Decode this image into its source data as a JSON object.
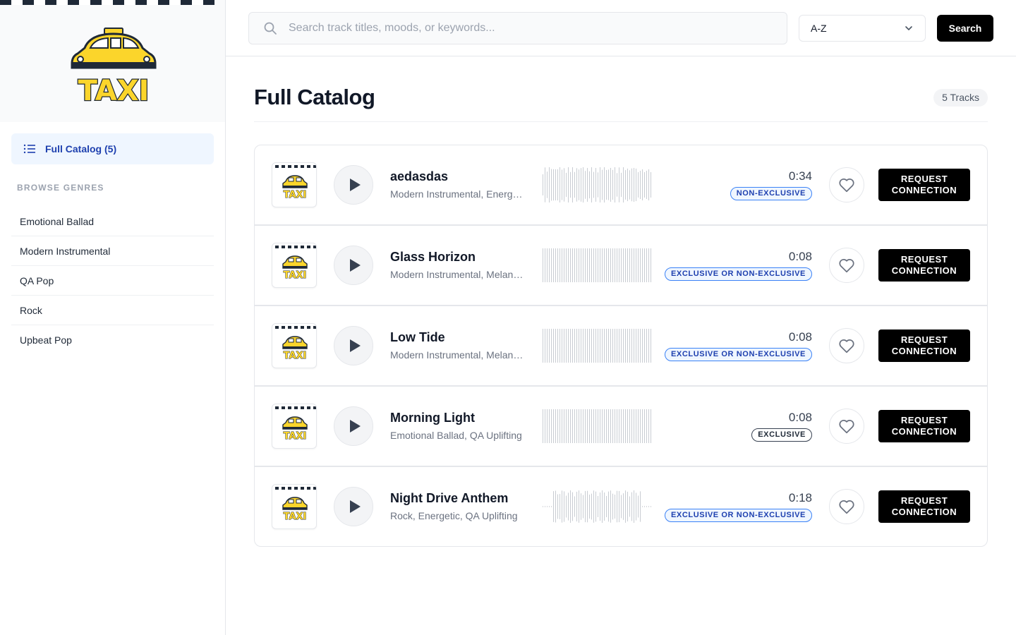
{
  "brand": {
    "logo_text": "TAXI"
  },
  "sidebar": {
    "active_item": {
      "label": "Full Catalog (5)"
    },
    "genres_heading": "BROWSE GENRES",
    "genres": [
      {
        "label": "Emotional Ballad"
      },
      {
        "label": "Modern Instrumental"
      },
      {
        "label": "QA Pop"
      },
      {
        "label": "Rock"
      },
      {
        "label": "Upbeat Pop"
      }
    ]
  },
  "topbar": {
    "search_placeholder": "Search track titles, moods, or keywords...",
    "search_value": "",
    "sort_value": "A-Z",
    "search_button": "Search"
  },
  "page": {
    "title": "Full Catalog",
    "count": "5 Tracks"
  },
  "tracks": [
    {
      "title": "aedasdas",
      "meta": "Modern Instrumental, Energetic",
      "duration": "0:34",
      "license": "NON-EXCLUSIVE",
      "license_style": "blue",
      "action": "REQUEST\nCONNECTION",
      "wave": "full"
    },
    {
      "title": "Glass Horizon",
      "meta": "Modern Instrumental, Melancholic",
      "duration": "0:08",
      "license": "EXCLUSIVE OR NON-EXCLUSIVE",
      "license_style": "blue",
      "action": "REQUEST\nCONNECTION",
      "wave": "flat"
    },
    {
      "title": "Low Tide",
      "meta": "Modern Instrumental, Melancholic",
      "duration": "0:08",
      "license": "EXCLUSIVE OR NON-EXCLUSIVE",
      "license_style": "blue",
      "action": "REQUEST\nCONNECTION",
      "wave": "flat"
    },
    {
      "title": "Morning Light",
      "meta": "Emotional Ballad, QA Uplifting",
      "duration": "0:08",
      "license": "EXCLUSIVE",
      "license_style": "dark",
      "action": "REQUEST\nCONNECTION",
      "wave": "flat"
    },
    {
      "title": "Night Drive Anthem",
      "meta": "Rock, Energetic, QA Uplifting",
      "duration": "0:18",
      "license": "EXCLUSIVE OR NON-EXCLUSIVE",
      "license_style": "blue",
      "action": "REQUEST\nCONNECTION",
      "wave": "taper"
    }
  ],
  "colors": {
    "accent": "#1e40af",
    "badge_blue_border": "#3b82f6",
    "logo_yellow": "#fbd52b",
    "button_black": "#000000"
  },
  "icons": {
    "nav": "list-icon",
    "search": "search-icon",
    "sort": "chevron-down-icon",
    "play": "play-icon",
    "favorite": "heart-icon"
  }
}
